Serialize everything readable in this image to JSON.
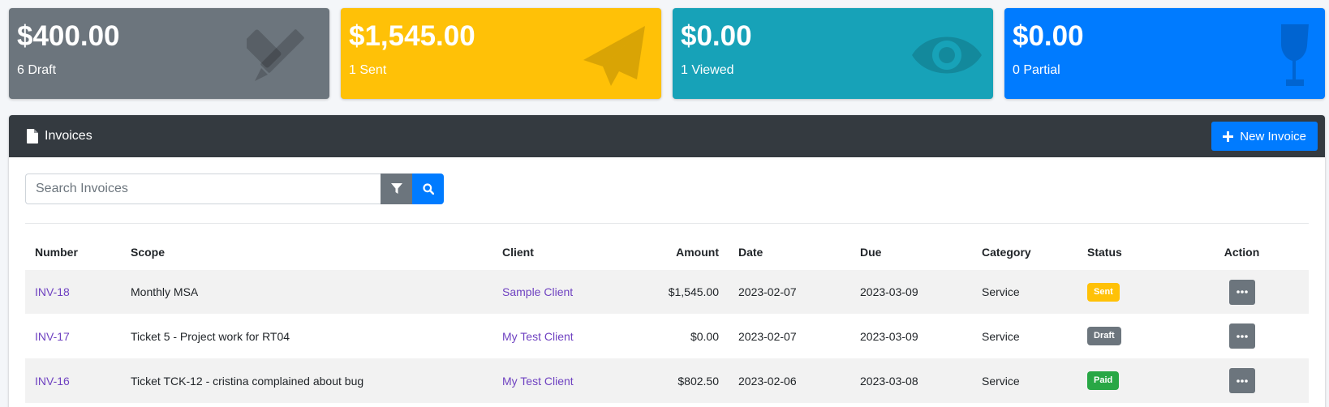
{
  "cards": [
    {
      "amount": "$400.00",
      "label": "6 Draft",
      "icon": "pencil-ruler-icon",
      "color": "#6c757d"
    },
    {
      "amount": "$1,545.00",
      "label": "1 Sent",
      "icon": "paper-plane-icon",
      "color": "#ffc107"
    },
    {
      "amount": "$0.00",
      "label": "1 Viewed",
      "icon": "eye-icon",
      "color": "#17a2b8"
    },
    {
      "amount": "$0.00",
      "label": "0 Partial",
      "icon": "wine-glass-icon",
      "color": "#007bff"
    }
  ],
  "panel": {
    "title": "Invoices",
    "new_button_label": "New Invoice",
    "search_placeholder": "Search Invoices"
  },
  "table": {
    "headers": {
      "number": "Number",
      "scope": "Scope",
      "client": "Client",
      "amount": "Amount",
      "date": "Date",
      "due": "Due",
      "category": "Category",
      "status": "Status",
      "action": "Action"
    },
    "rows": [
      {
        "number": "INV-18",
        "scope": "Monthly MSA",
        "client": "Sample Client",
        "amount": "$1,545.00",
        "date": "2023-02-07",
        "due": "2023-03-09",
        "category": "Service",
        "status": "Sent"
      },
      {
        "number": "INV-17",
        "scope": "Ticket 5 - Project work for RT04",
        "client": "My Test Client",
        "amount": "$0.00",
        "date": "2023-02-07",
        "due": "2023-03-09",
        "category": "Service",
        "status": "Draft"
      },
      {
        "number": "INV-16",
        "scope": "Ticket TCK-12 - cristina complained about bug",
        "client": "My Test Client",
        "amount": "$802.50",
        "date": "2023-02-06",
        "due": "2023-03-08",
        "category": "Service",
        "status": "Paid"
      }
    ]
  },
  "colors": {
    "header_dark": "#343a40",
    "primary": "#007bff",
    "link": "#6f42c1",
    "sent": "#ffc107",
    "draft": "#6c757d",
    "paid": "#28a745"
  }
}
